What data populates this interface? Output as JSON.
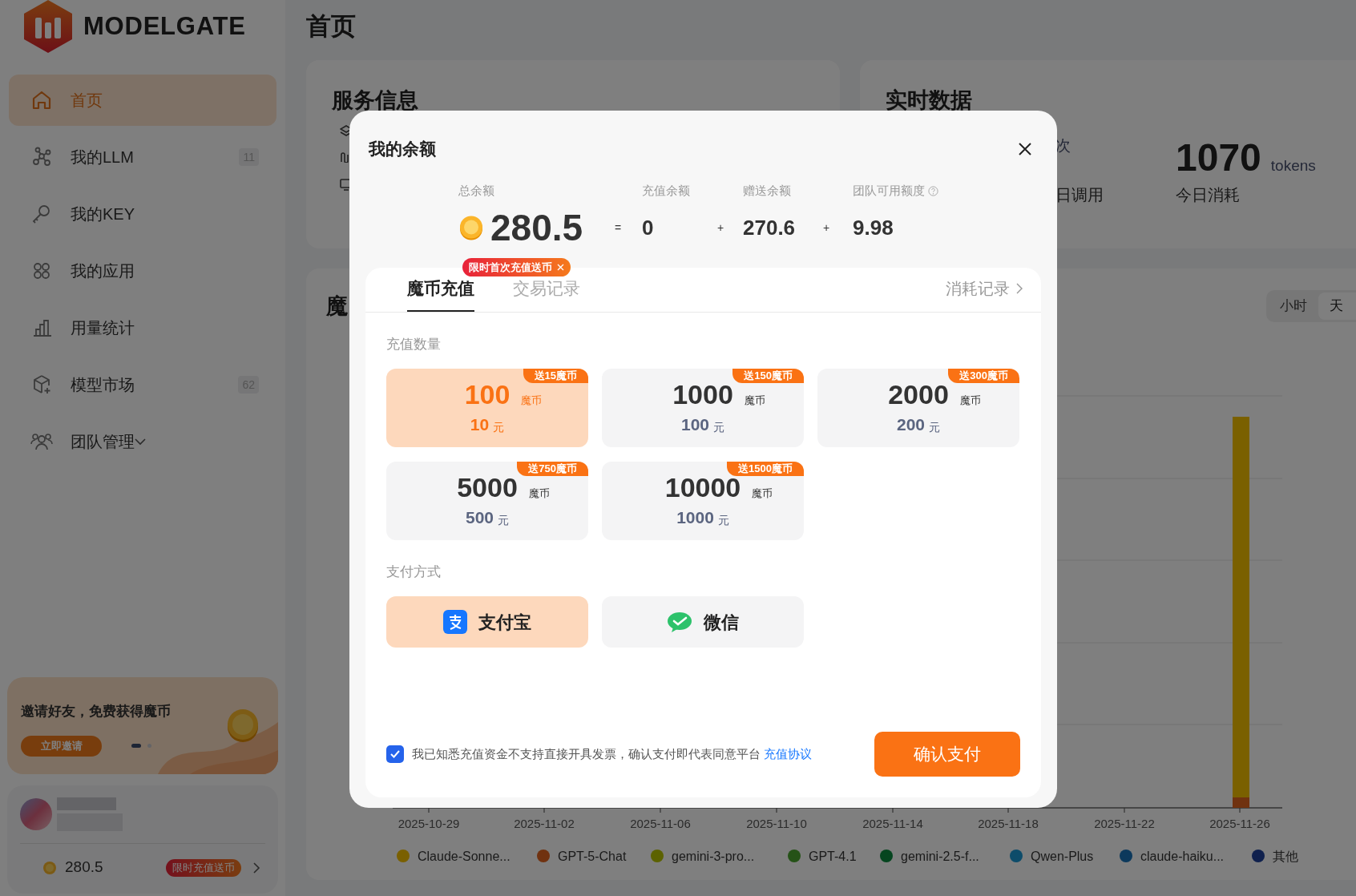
{
  "brand": {
    "name": "MODELGATE"
  },
  "sidebar": {
    "items": [
      {
        "label": "首页",
        "kind": "home",
        "selected": true
      },
      {
        "label": "我的LLM",
        "kind": "nodes",
        "badge": "11",
        "selected": false
      },
      {
        "label": "我的KEY",
        "kind": "key",
        "selected": false
      },
      {
        "label": "我的应用",
        "kind": "apps",
        "selected": false
      },
      {
        "label": "用量统计",
        "kind": "bars",
        "selected": false
      },
      {
        "label": "模型市场",
        "kind": "cube",
        "badge": "62",
        "selected": false
      },
      {
        "label": "团队管理",
        "kind": "team",
        "expandable": true,
        "selected": false
      }
    ]
  },
  "invite_card": {
    "text": "邀请好友，免费获得魔币",
    "button": "立即邀请",
    "pager": [
      {
        "selected": true
      },
      {
        "selected": false
      }
    ]
  },
  "account": {
    "balance": "280.5",
    "promo": "限时充值送币"
  },
  "page_title": "首页",
  "service_card": {
    "title": "服务信息"
  },
  "realtime_card": {
    "title": "实时数据",
    "stats": [
      {
        "unit": "次",
        "label": "日调用"
      },
      {
        "value": "1070",
        "unit": "tokens",
        "label": "今日消耗"
      }
    ]
  },
  "chart_card": {
    "title": "魔",
    "granularity": [
      {
        "label": "小时",
        "selected": false
      },
      {
        "label": "天",
        "selected": true
      }
    ],
    "x_labels": [
      "2025-10-29",
      "2025-11-02",
      "2025-11-06",
      "2025-11-10",
      "2025-11-14",
      "2025-11-18",
      "2025-11-22",
      "2025-11-26"
    ],
    "legend": [
      {
        "name": "Claude-Sonne...",
        "color": "#7a6000"
      },
      {
        "name": "GPT-5-Chat",
        "color": "#703210"
      },
      {
        "name": "gemini-3-pro...",
        "color": "#5c6200"
      },
      {
        "name": "GPT-4.1",
        "color": "#255217"
      },
      {
        "name": "gemini-2.5-f...",
        "color": "#05451f"
      },
      {
        "name": "Qwen-Plus",
        "color": "#0d4c6a"
      },
      {
        "name": "claude-haiku...",
        "color": "#0c395c"
      },
      {
        "name": "其他",
        "color": "#0f204d"
      }
    ]
  },
  "dialog": {
    "title": "我的余额",
    "balances": [
      {
        "label": "总余额",
        "value": "280.5",
        "kind": "total"
      },
      {
        "operator": "=",
        "label": "充值余额",
        "value": "0",
        "kind": "part"
      },
      {
        "operator": "+",
        "label": "赠送余额",
        "value": "270.6",
        "kind": "part"
      },
      {
        "operator": "+",
        "label": "团队可用额度",
        "value": "9.98",
        "kind": "part",
        "help": true
      }
    ],
    "promo_badge": "限时首次充值送币",
    "tabs": [
      {
        "label": "魔币充值",
        "selected": true
      },
      {
        "label": "交易记录",
        "selected": false
      }
    ],
    "history_link": "消耗记录",
    "amount_label": "充值数量",
    "packages": [
      {
        "coins": "100",
        "coin_unit": "魔币",
        "price": "10",
        "price_unit": "元",
        "bonus": "送15魔币",
        "selected": true
      },
      {
        "coins": "1000",
        "coin_unit": "魔币",
        "price": "100",
        "price_unit": "元",
        "bonus": "送150魔币",
        "selected": false
      },
      {
        "coins": "2000",
        "coin_unit": "魔币",
        "price": "200",
        "price_unit": "元",
        "bonus": "送300魔币",
        "selected": false
      },
      {
        "coins": "5000",
        "coin_unit": "魔币",
        "price": "500",
        "price_unit": "元",
        "bonus": "送750魔币",
        "selected": false
      },
      {
        "coins": "10000",
        "coin_unit": "魔币",
        "price": "1000",
        "price_unit": "元",
        "bonus": "送1500魔币",
        "selected": false
      }
    ],
    "payment_label": "支付方式",
    "payment_methods": [
      {
        "label": "支付宝",
        "kind": "alipay",
        "selected": true
      },
      {
        "label": "微信",
        "kind": "wechat",
        "selected": false
      }
    ],
    "agreement": {
      "checked": true,
      "text": "我已知悉充值资金不支持直接开具发票，确认支付即代表同意平台",
      "link": "充值协议"
    },
    "confirm_button": "确认支付"
  }
}
